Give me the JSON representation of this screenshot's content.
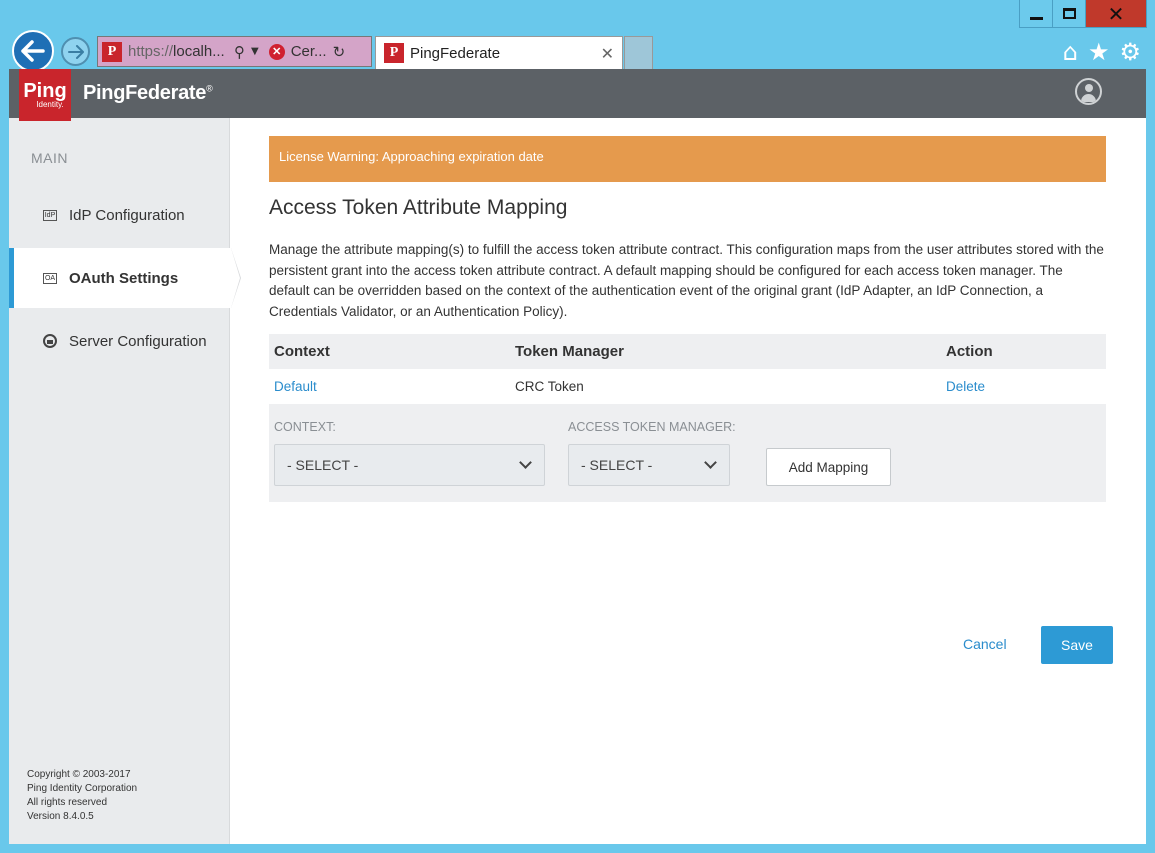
{
  "browser": {
    "url": "https://localh...",
    "url_proto": "https://",
    "url_host": "localh...",
    "cert_text": "Cer...",
    "tab_title": "PingFederate",
    "favicon_text": "P"
  },
  "header": {
    "logo_big": "Ping",
    "logo_small": "Identity.",
    "brand": "PingFederate",
    "brand_mark": "®"
  },
  "sidebar": {
    "heading": "MAIN",
    "items": [
      {
        "label": "IdP Configuration",
        "icon": "IdP"
      },
      {
        "label": "OAuth Settings",
        "icon": "OA"
      },
      {
        "label": "Server Configuration",
        "icon": "server-icon"
      }
    ],
    "copyright": [
      "Copyright © 2003-2017",
      "Ping Identity Corporation",
      "All rights reserved",
      "Version 8.4.0.5"
    ]
  },
  "main": {
    "warning": "License Warning: Approaching expiration date",
    "title": "Access Token Attribute Mapping",
    "description": "Manage the attribute mapping(s) to fulfill the access token attribute contract. This configuration maps from the user attributes stored with the persistent grant into the access token attribute contract. A default mapping should be configured for each access token manager. The default can be overridden based on the context of the authentication event of the original grant (IdP Adapter, an IdP Connection, a Credentials Validator, or an Authentication Policy).",
    "table": {
      "headers": {
        "context": "Context",
        "manager": "Token Manager",
        "action": "Action"
      },
      "rows": [
        {
          "context": "Default",
          "manager": "CRC Token",
          "action": "Delete"
        }
      ]
    },
    "add": {
      "context_label": "CONTEXT:",
      "context_value": "- SELECT -",
      "manager_label": "ACCESS TOKEN MANAGER:",
      "manager_value": "- SELECT -",
      "button": "Add Mapping"
    },
    "cancel": "Cancel",
    "save": "Save"
  }
}
